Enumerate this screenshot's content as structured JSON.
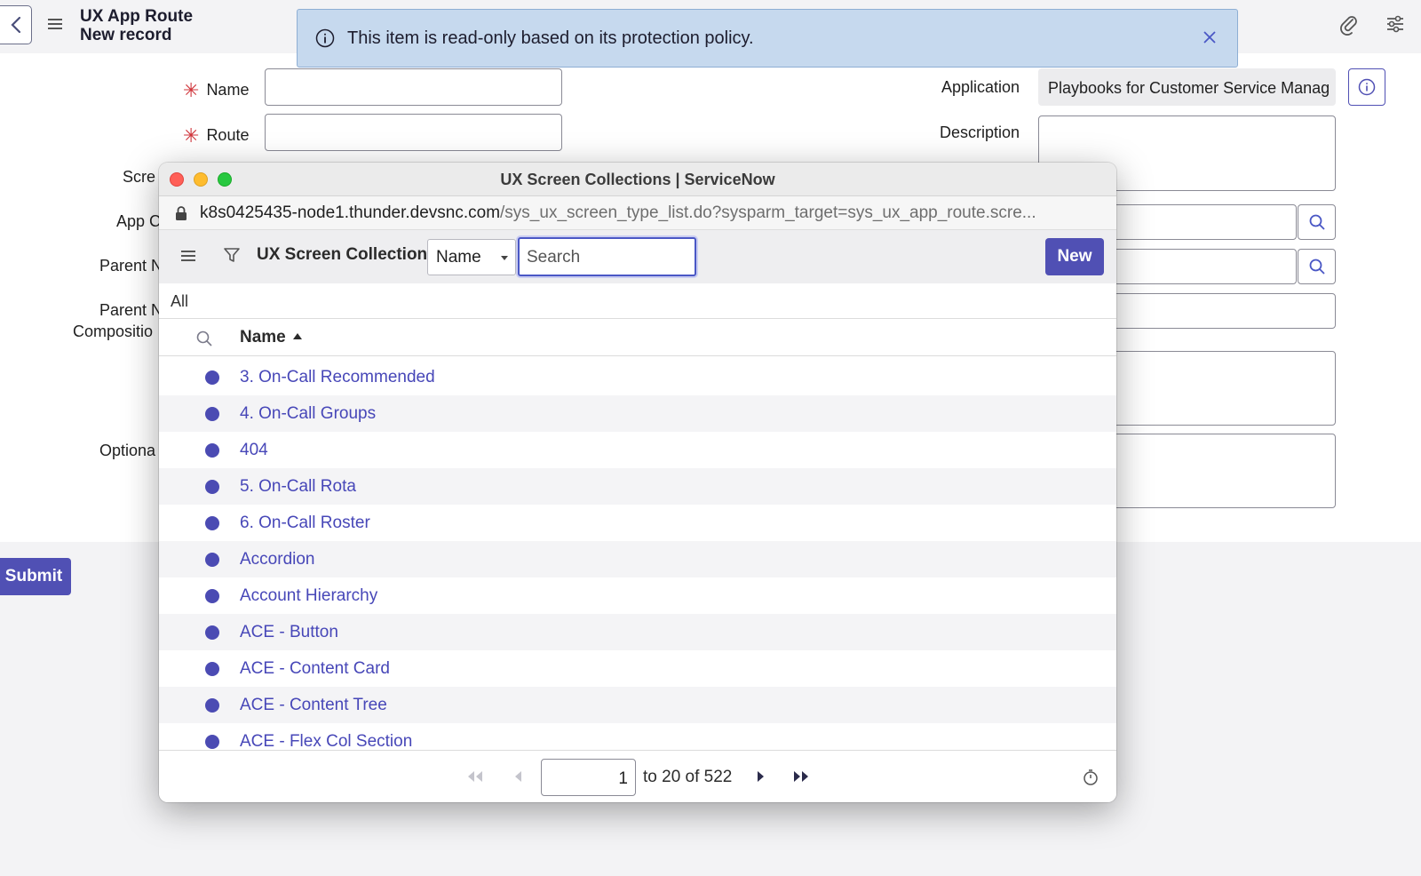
{
  "header": {
    "title_line1": "UX App Route",
    "title_line2": "New record",
    "icons": [
      "chevron-left-icon",
      "hamburger-icon",
      "paperclip-icon",
      "settings-sliders-icon"
    ]
  },
  "alert": {
    "message": "This item is read-only based on its protection policy."
  },
  "form": {
    "name_label": "Name",
    "route_label": "Route",
    "screen_label_partial": "Scre",
    "appc_label_partial": "App C",
    "parent_label_partial": "Parent N",
    "parent2_label_partial": "Parent N",
    "composition_label_partial": "Compositio",
    "optional_label_partial": "Optiona",
    "application_label": "Application",
    "application_value": "Playbooks for Customer Service Manag",
    "description_label": "Description",
    "submit_label": "Submit"
  },
  "popup": {
    "window_title": "UX Screen Collections | ServiceNow",
    "url_host": "k8s0425435-node1.thunder.devsnc.com",
    "url_path": "/sys_ux_screen_type_list.do?sysparm_target=sys_ux_app_route.scre...",
    "toolbar_title": "UX Screen Collections",
    "search_field_select": "Name",
    "search_placeholder": "Search",
    "new_label": "New",
    "breadcrumb": "All",
    "column_name": "Name",
    "rows": [
      "3. On-Call Recommended",
      "4. On-Call Groups",
      "404",
      "5. On-Call Rota",
      "6. On-Call Roster",
      "Accordion",
      "Account Hierarchy",
      "ACE - Button",
      "ACE - Content Card",
      "ACE - Content Tree",
      "ACE - Flex Col Section"
    ],
    "pagination": {
      "page": "1",
      "range_text": "to 20 of 522"
    }
  },
  "colors": {
    "accent": "#5050b4",
    "link": "#4747b8",
    "alert_bg": "#c6d9ee",
    "required": "#d0343a"
  }
}
